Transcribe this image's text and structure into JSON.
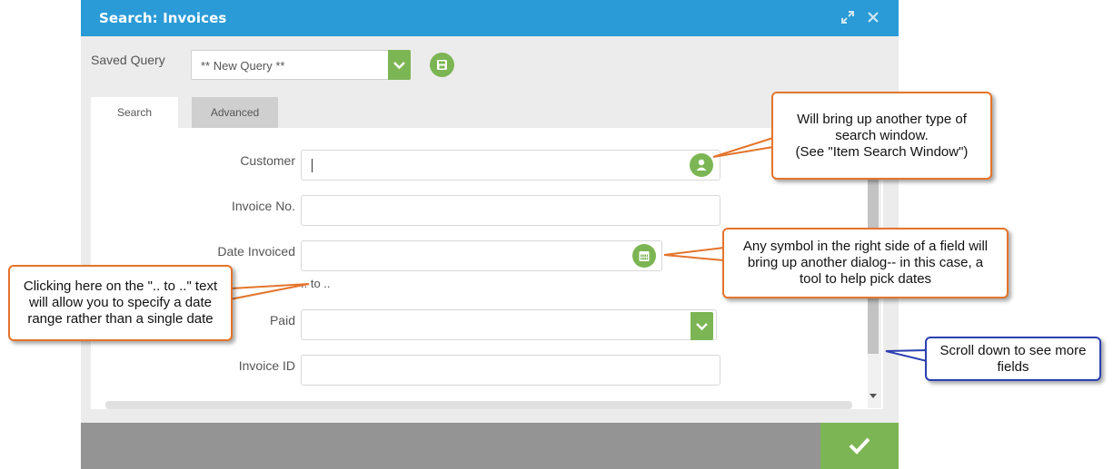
{
  "dialog": {
    "title": "Search: Invoices",
    "saved_query_label": "Saved Query",
    "saved_query_value": "** New Query **",
    "tabs": [
      {
        "label": "Search",
        "active": true
      },
      {
        "label": "Advanced",
        "active": false
      }
    ],
    "fields": {
      "customer": {
        "label": "Customer",
        "value": ""
      },
      "invoice_no": {
        "label": "Invoice No.",
        "value": ""
      },
      "date_invoiced": {
        "label": "Date Invoiced",
        "value": "",
        "range_text": ".. to .."
      },
      "paid": {
        "label": "Paid",
        "value": ""
      },
      "invoice_id": {
        "label": "Invoice ID",
        "value": ""
      }
    }
  },
  "callouts": {
    "customer_lookup": [
      "Will bring up another type of",
      "search window.",
      "(See \"Item Search Window\")"
    ],
    "field_symbol": [
      "Any symbol in the right side of a field will",
      "bring up another dialog-- in this case, a",
      "tool to help pick dates"
    ],
    "date_range": [
      "Clicking here on the \".. to ..\" text",
      "will allow you to specify a date",
      "range rather than a single date"
    ],
    "scroll": [
      "Scroll down to see more",
      "fields"
    ]
  },
  "colors": {
    "titlebar": "#2a9bd7",
    "accent_green": "#7cb553",
    "callout_orange": "#e4742b",
    "callout_blue": "#2a3fb0"
  },
  "icons": {
    "expand": "expand-icon",
    "close": "close-icon",
    "save": "save-icon",
    "customer_lookup": "user-icon",
    "date_picker": "calendar-icon",
    "dropdown": "chevron-down-icon",
    "ok": "checkmark-icon"
  }
}
